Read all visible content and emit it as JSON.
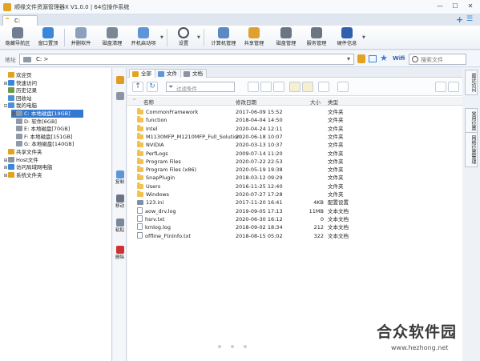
{
  "window": {
    "title": "顺缘文件资源管理器X V1.0.0 | 64位操作系统",
    "controls": [
      "—",
      "☐",
      "✕"
    ]
  },
  "tabs": [
    {
      "label": "C:"
    }
  ],
  "ribbon": {
    "buttons": [
      {
        "label": "隐藏导航区",
        "icon": "navigation-pane-icon",
        "color": "#6f7e92"
      },
      {
        "label": "窗口置顶",
        "icon": "pin-icon",
        "color": "#3a86d8"
      },
      {
        "label": "并删软件",
        "icon": "uninstall-icon",
        "color": "#8aa0bd"
      },
      {
        "label": "磁盘清理",
        "icon": "disk-cleanup-icon",
        "color": "#7a8797"
      },
      {
        "label": "开机启动项",
        "icon": "startup-icon",
        "color": "#5e95d6"
      },
      {
        "label": "设置",
        "icon": "gear-icon",
        "color": "#4a4f58"
      },
      {
        "label": "计算机管理",
        "icon": "computer-manage-icon",
        "color": "#5b89c4"
      },
      {
        "label": "共享管理",
        "icon": "share-icon",
        "color": "#e0a030"
      },
      {
        "label": "磁盘管理",
        "icon": "disk-manage-icon",
        "color": "#6b7584"
      },
      {
        "label": "服务管理",
        "icon": "service-icon",
        "color": "#6b7584"
      },
      {
        "label": "硬件信息",
        "icon": "hardware-icon",
        "color": "#2f5fae"
      }
    ]
  },
  "address": {
    "label": "地址",
    "path": "C: >",
    "search_placeholder": "搜索文件"
  },
  "tree": [
    {
      "label": "欢迎页",
      "indent": 0,
      "toggle": "",
      "color": "#e3a322"
    },
    {
      "label": "快速访问",
      "indent": 0,
      "toggle": "⊞",
      "color": "#3a86d8"
    },
    {
      "label": "历史记录",
      "indent": 0,
      "toggle": "",
      "color": "#6a9a4a"
    },
    {
      "label": "回收站",
      "indent": 0,
      "toggle": "",
      "color": "#4e8fd8"
    },
    {
      "label": "我的电脑",
      "indent": 0,
      "toggle": "⊟",
      "color": "#4e8fd8"
    },
    {
      "label": "C: 本地磁盘[19GB]",
      "indent": 1,
      "toggle": "⊞",
      "color": "#8f9aa8",
      "selected": true
    },
    {
      "label": "D: 软件[6GB]",
      "indent": 1,
      "toggle": "",
      "color": "#8f9aa8"
    },
    {
      "label": "E: 本地磁盘[70GB]",
      "indent": 1,
      "toggle": "",
      "color": "#8f9aa8"
    },
    {
      "label": "F: 本地磁盘[151GB]",
      "indent": 1,
      "toggle": "",
      "color": "#8f9aa8"
    },
    {
      "label": "G: 本地磁盘[140GB]",
      "indent": 1,
      "toggle": "",
      "color": "#8f9aa8"
    },
    {
      "label": "共享文件夹",
      "indent": 0,
      "toggle": "",
      "color": "#e3a322"
    },
    {
      "label": "Host文件",
      "indent": 0,
      "toggle": "⊞",
      "color": "#8a94a3"
    },
    {
      "label": "访问局域网电脑",
      "indent": 0,
      "toggle": "⊞",
      "color": "#3a86d8"
    },
    {
      "label": "系统文件夹",
      "indent": 0,
      "toggle": "⊞",
      "color": "#e3a322"
    }
  ],
  "actions": [
    {
      "label": "",
      "icon": "folder-open-icon",
      "color": "#e39a22"
    },
    {
      "label": "",
      "icon": "window-icon",
      "color": "#8a94a3"
    },
    {
      "label": "复制",
      "icon": "copy-icon",
      "color": "#5e95d6"
    },
    {
      "label": "移动",
      "icon": "move-icon",
      "color": "#6b7584"
    },
    {
      "label": "粘贴",
      "icon": "paste-icon",
      "color": "#7a8797"
    },
    {
      "label": "删除",
      "icon": "delete-icon",
      "color": "#d03030"
    }
  ],
  "pane_tabs": [
    {
      "label": "全部",
      "color": "#e3a322"
    },
    {
      "label": "文件",
      "color": "#5e95d6"
    },
    {
      "label": "文档",
      "color": "#8a94a3"
    }
  ],
  "filter_placeholder": "过滤条件",
  "columns": {
    "name": "名称",
    "date": "修改日期",
    "size": "大小",
    "type": "类型"
  },
  "files": [
    {
      "name": "CommonFramework",
      "date": "2017-06-09 15:52",
      "size": "",
      "type": "文件夹",
      "kind": "folder"
    },
    {
      "name": "function",
      "date": "2018-04-04 14:50",
      "size": "",
      "type": "文件夹",
      "kind": "folder"
    },
    {
      "name": "Intel",
      "date": "2020-04-24 12:11",
      "size": "",
      "type": "文件夹",
      "kind": "folder"
    },
    {
      "name": "M1130MFP_M1210MFP_Full_Solution",
      "date": "2020-06-18 10:07",
      "size": "",
      "type": "文件夹",
      "kind": "folder"
    },
    {
      "name": "NVIDIA",
      "date": "2020-03-13 10:37",
      "size": "",
      "type": "文件夹",
      "kind": "folder"
    },
    {
      "name": "PerfLogs",
      "date": "2009-07-14 11:20",
      "size": "",
      "type": "文件夹",
      "kind": "folder"
    },
    {
      "name": "Program Files",
      "date": "2020-07-22 22:53",
      "size": "",
      "type": "文件夹",
      "kind": "folder"
    },
    {
      "name": "Program Files (x86)",
      "date": "2020-05-19 19:38",
      "size": "",
      "type": "文件夹",
      "kind": "folder"
    },
    {
      "name": "SnapPlugin",
      "date": "2018-03-12 09:29",
      "size": "",
      "type": "文件夹",
      "kind": "folder"
    },
    {
      "name": "Users",
      "date": "2016-11-25 12:40",
      "size": "",
      "type": "文件夹",
      "kind": "folder"
    },
    {
      "name": "Windows",
      "date": "2020-07-27 17:28",
      "size": "",
      "type": "文件夹",
      "kind": "folder"
    },
    {
      "name": "123.ini",
      "date": "2017-11-20 16:41",
      "size": "4KB",
      "type": "配置设置",
      "kind": "cfg"
    },
    {
      "name": "aow_drv.log",
      "date": "2019-09-05 17:13",
      "size": "11MB",
      "type": "文本文档",
      "kind": "file"
    },
    {
      "name": "hsrv.txt",
      "date": "2020-06-30 16:12",
      "size": "0",
      "type": "文本文档",
      "kind": "file"
    },
    {
      "name": "kmlog.log",
      "date": "2018-09-02 18:34",
      "size": "212",
      "type": "文本文档",
      "kind": "file"
    },
    {
      "name": "offline_FtnInfo.txt",
      "date": "2018-08-15 05:02",
      "size": "322",
      "type": "文本文档",
      "kind": "file"
    }
  ],
  "side_tabs": [
    "最近访问",
    "常用位置",
    "网络位置管理"
  ],
  "watermark": {
    "title": "合众软件园",
    "url": "www.hezhong.net"
  }
}
